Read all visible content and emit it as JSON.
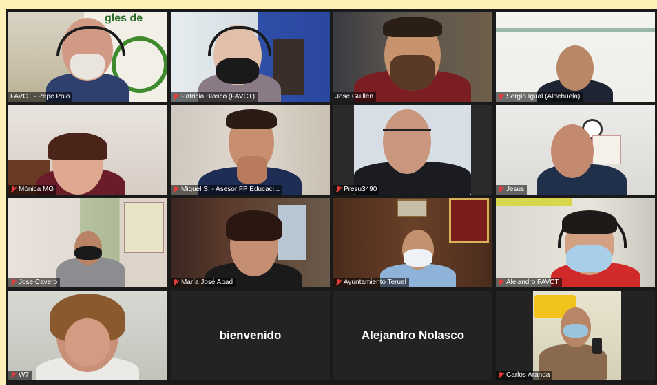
{
  "participants": [
    {
      "name": "FAVCT - Pepe Polo",
      "muted": false
    },
    {
      "name": "Patricia Blasco (FAVCT)",
      "muted": true
    },
    {
      "name": "Jose Guillén",
      "muted": false,
      "active_speaker": true
    },
    {
      "name": "Sergio Igual (Aldehuela)",
      "muted": true
    },
    {
      "name": "Mónica MG",
      "muted": true
    },
    {
      "name": "Miguel S. - Asesor FP Educaci...",
      "muted": true
    },
    {
      "name": "Presu3490",
      "muted": true
    },
    {
      "name": "Jesus",
      "muted": true
    },
    {
      "name": "Jose Cavero",
      "muted": true
    },
    {
      "name": "María José Abad",
      "muted": true
    },
    {
      "name": "Ayuntamiento Teruel",
      "muted": true
    },
    {
      "name": "Alejandro FAVCT",
      "muted": true
    },
    {
      "name": "W7",
      "muted": true
    },
    {
      "name": "bienvenido",
      "video_off": true
    },
    {
      "name": "Alejandro Nolasco",
      "video_off": true
    },
    {
      "name": "Carlos Aranda",
      "muted": true
    }
  ],
  "background_text": {
    "banner": "gles de"
  },
  "colors": {
    "active_border": "#c8e04a",
    "mute": "#e43b3b",
    "window_bg": "#fdf1b8"
  }
}
